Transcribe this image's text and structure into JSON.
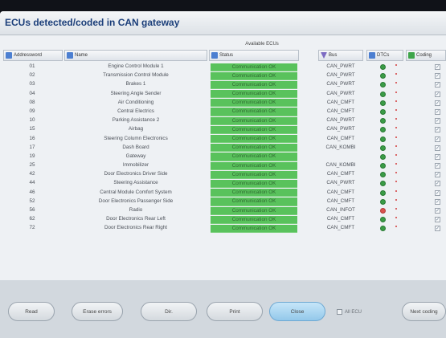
{
  "window": {
    "title": "ECUs detected/coded in CAN gateway"
  },
  "section_label": "Available ECUs",
  "columns": {
    "address": "Addressword",
    "name": "Name",
    "status": "Status",
    "bus": "Bus",
    "dtcs": "DTCs",
    "coding": "Coding"
  },
  "rows": [
    {
      "address": "01",
      "name": "Engine Control Module 1",
      "status": "Communication OK",
      "bus": "CAN_PWRT",
      "dtc": "ok"
    },
    {
      "address": "02",
      "name": "Transmission Control Module",
      "status": "Communication OK",
      "bus": "CAN_PWRT",
      "dtc": "ok"
    },
    {
      "address": "03",
      "name": "Brakes 1",
      "status": "Communication OK",
      "bus": "CAN_PWRT",
      "dtc": "ok"
    },
    {
      "address": "04",
      "name": "Steering Angle Sender",
      "status": "Communication OK",
      "bus": "CAN_PWRT",
      "dtc": "ok"
    },
    {
      "address": "08",
      "name": "Air Conditioning",
      "status": "Communication OK",
      "bus": "CAN_CMFT",
      "dtc": "ok"
    },
    {
      "address": "09",
      "name": "Central Electrics",
      "status": "Communication OK",
      "bus": "CAN_CMFT",
      "dtc": "ok"
    },
    {
      "address": "10",
      "name": "Parking Assistance 2",
      "status": "Communication OK",
      "bus": "CAN_PWRT",
      "dtc": "ok"
    },
    {
      "address": "15",
      "name": "Airbag",
      "status": "Communication OK",
      "bus": "CAN_PWRT",
      "dtc": "ok"
    },
    {
      "address": "16",
      "name": "Steering Column Electronics",
      "status": "Communication OK",
      "bus": "CAN_CMFT",
      "dtc": "ok"
    },
    {
      "address": "17",
      "name": "Dash Board",
      "status": "Communication OK",
      "bus": "CAN_KOMBI",
      "dtc": "ok"
    },
    {
      "address": "19",
      "name": "Gateway",
      "status": "Communication OK",
      "bus": "",
      "dtc": "ok"
    },
    {
      "address": "25",
      "name": "Immobilizer",
      "status": "Communication OK",
      "bus": "CAN_KOMBI",
      "dtc": "ok"
    },
    {
      "address": "42",
      "name": "Door Electronics Driver Side",
      "status": "Communication OK",
      "bus": "CAN_CMFT",
      "dtc": "ok"
    },
    {
      "address": "44",
      "name": "Steering Assistance",
      "status": "Communication OK",
      "bus": "CAN_PWRT",
      "dtc": "ok"
    },
    {
      "address": "46",
      "name": "Central Module Comfort System",
      "status": "Communication OK",
      "bus": "CAN_CMFT",
      "dtc": "ok"
    },
    {
      "address": "52",
      "name": "Door Electronics Passenger Side",
      "status": "Communication OK",
      "bus": "CAN_CMFT",
      "dtc": "ok"
    },
    {
      "address": "56",
      "name": "Radio",
      "status": "Communication OK",
      "bus": "CAN_INFOT",
      "dtc": "error"
    },
    {
      "address": "62",
      "name": "Door Electronics Rear Left",
      "status": "Communication OK",
      "bus": "CAN_CMFT",
      "dtc": "ok"
    },
    {
      "address": "72",
      "name": "Door Electronics Rear Right",
      "status": "Communication OK",
      "bus": "CAN_CMFT",
      "dtc": "ok"
    }
  ],
  "buttons": {
    "read": "Read",
    "erase": "Erase errors",
    "dir": "Dir.",
    "print": "Print",
    "close": "Close",
    "all_ecus": "All ECU",
    "next": "Next coding"
  },
  "colors": {
    "status_ok": "#59c25c",
    "dtc_ok": "#3a9c46",
    "dtc_error": "#d9534f",
    "accent": "#93c8ea"
  }
}
